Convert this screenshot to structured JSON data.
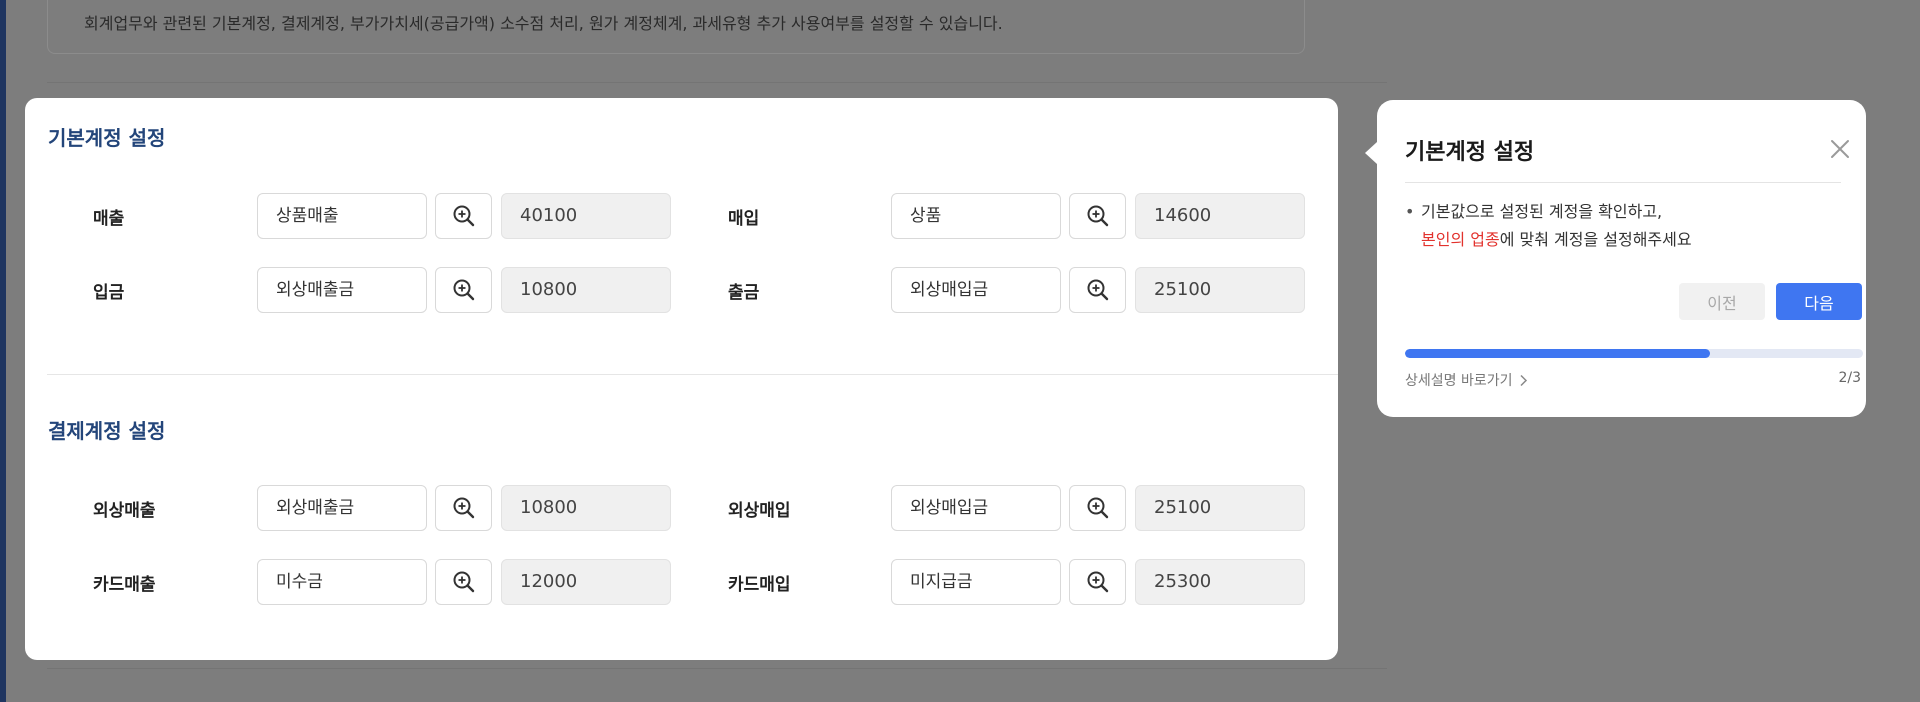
{
  "background": {
    "description_text": "회계업무와 관련된 기본계정, 결제계정, 부가가치세(공급가액) 소수점 처리, 원가 계정체계, 과세유형 추가 사용여부를 설정할 수 있습니다."
  },
  "basic_section": {
    "title": "기본계정 설정",
    "rows": [
      {
        "left": {
          "label": "매출",
          "account": "상품매출",
          "code": "40100"
        },
        "right": {
          "label": "매입",
          "account": "상품",
          "code": "14600"
        }
      },
      {
        "left": {
          "label": "입금",
          "account": "외상매출금",
          "code": "10800"
        },
        "right": {
          "label": "출금",
          "account": "외상매입금",
          "code": "25100"
        }
      }
    ]
  },
  "payment_section": {
    "title": "결제계정 설정",
    "rows": [
      {
        "left": {
          "label": "외상매출",
          "account": "외상매출금",
          "code": "10800"
        },
        "right": {
          "label": "외상매입",
          "account": "외상매입금",
          "code": "25100"
        }
      },
      {
        "left": {
          "label": "카드매출",
          "account": "미수금",
          "code": "12000"
        },
        "right": {
          "label": "카드매입",
          "account": "미지급금",
          "code": "25300"
        }
      }
    ]
  },
  "popover": {
    "title": "기본계정 설정",
    "bullet": "•",
    "line1": "기본값으로 설정된 계정을 확인하고,",
    "line2_highlight": "본인의 업종",
    "line2_rest": "에 맞춰 계정을 설정해주세요",
    "prev_label": "이전",
    "next_label": "다음",
    "progress_percent": 66.7,
    "link_label": "상세설명 바로가기",
    "step": "2/3"
  },
  "colors": {
    "section_title": "#23457a",
    "highlight_text": "#e2322d",
    "primary_button": "#3f76f1",
    "overlay": "#7d7d7d"
  },
  "icons": {
    "lookup": "zoom-in-icon",
    "close": "close-icon",
    "link_arrow": "chevron-right-icon"
  }
}
